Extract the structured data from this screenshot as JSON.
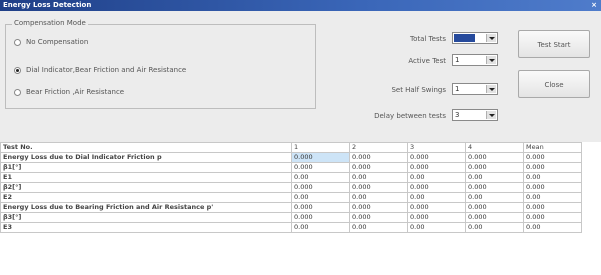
{
  "window": {
    "title": "Energy Loss Detection",
    "close_glyph": "×"
  },
  "compensation": {
    "legend": "Compensation Mode",
    "options": [
      {
        "label": "No Compensation",
        "checked": false
      },
      {
        "label": "Dial Indicator,Bear Friction and Air Resistance",
        "checked": true
      },
      {
        "label": "Bear Friction ,Air Resistance",
        "checked": false
      }
    ]
  },
  "settings": {
    "total_tests": {
      "label": "Total Tests",
      "value": "5"
    },
    "active_test": {
      "label": "Active Test",
      "value": "1"
    },
    "set_half_swings": {
      "label": "Set Half Swings",
      "value": "1"
    },
    "delay_between_tests": {
      "label": "Delay between tests",
      "value": "3"
    }
  },
  "buttons": {
    "test_start": "Test Start",
    "close": "Close"
  },
  "table": {
    "columns": [
      "Test No.",
      "1",
      "2",
      "3",
      "4",
      "Mean"
    ],
    "rows": [
      {
        "name": "Energy Loss due to Dial Indicator Friction p",
        "bold": true,
        "values": [
          "0.000",
          "0.000",
          "0.000",
          "0.000",
          "0.000"
        ]
      },
      {
        "name": "β1[°]",
        "bold": true,
        "values": [
          "0.000",
          "0.000",
          "0.000",
          "0.000",
          "0.000"
        ]
      },
      {
        "name": "E1",
        "bold": true,
        "values": [
          "0.00",
          "0.00",
          "0.00",
          "0.00",
          "0.00"
        ]
      },
      {
        "name": "β2[°]",
        "bold": true,
        "values": [
          "0.000",
          "0.000",
          "0.000",
          "0.000",
          "0.000"
        ]
      },
      {
        "name": "E2",
        "bold": true,
        "values": [
          "0.00",
          "0.00",
          "0.00",
          "0.00",
          "0.00"
        ]
      },
      {
        "name": "Energy Loss due to Bearing Friction and Air Resistance p'",
        "bold": true,
        "values": [
          "0.000",
          "0.000",
          "0.000",
          "0.000",
          "0.000"
        ]
      },
      {
        "name": "β3[°]",
        "bold": true,
        "values": [
          "0.000",
          "0.000",
          "0.000",
          "0.000",
          "0.000"
        ]
      },
      {
        "name": "E3",
        "bold": true,
        "values": [
          "0.00",
          "0.00",
          "0.00",
          "0.00",
          "0.00"
        ]
      }
    ]
  }
}
